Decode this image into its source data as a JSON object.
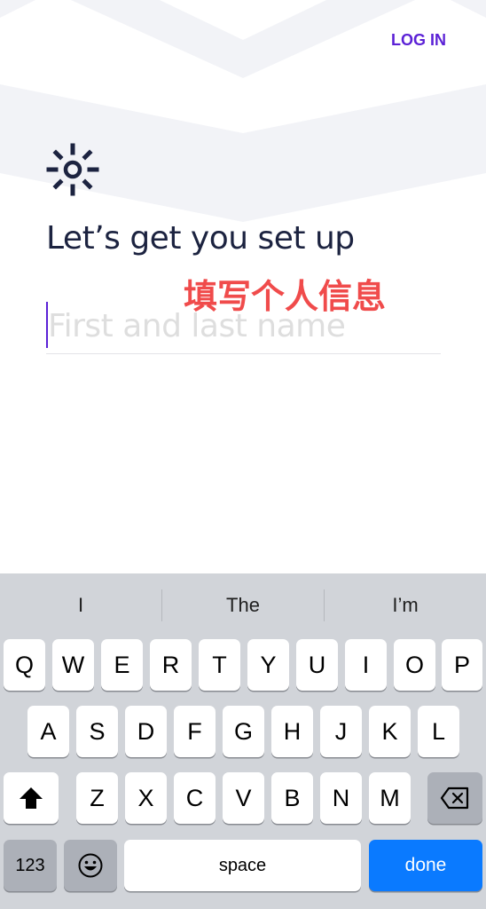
{
  "header": {
    "login_label": "LOG IN"
  },
  "main": {
    "title": "Let’s get you set up",
    "annotation": "填写个人信息",
    "name_input": {
      "placeholder": "First and last name",
      "value": ""
    }
  },
  "keyboard": {
    "suggestions": [
      "I",
      "The",
      "I’m"
    ],
    "row1": [
      "Q",
      "W",
      "E",
      "R",
      "T",
      "Y",
      "U",
      "I",
      "O",
      "P"
    ],
    "row2": [
      "A",
      "S",
      "D",
      "F",
      "G",
      "H",
      "J",
      "K",
      "L"
    ],
    "row3": [
      "Z",
      "X",
      "C",
      "V",
      "B",
      "N",
      "M"
    ],
    "numbers_label": "123",
    "space_label": "space",
    "done_label": "done"
  },
  "icons": {
    "logo": "sun-icon",
    "shift": "shift-arrow-icon",
    "backspace": "backspace-icon",
    "emoji": "emoji-icon"
  },
  "colors": {
    "accent": "#5b21d6",
    "title": "#1c2340",
    "annotation": "#f04b4b",
    "keyboard_bg": "#d1d4d9",
    "done_key": "#0a7aff",
    "chevron_bg": "#f2f3f7"
  }
}
